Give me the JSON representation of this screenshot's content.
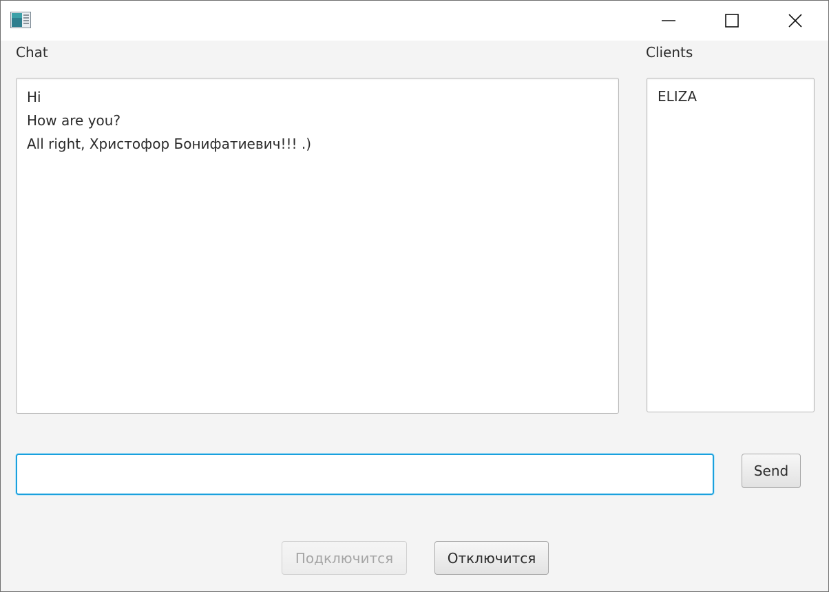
{
  "window": {
    "icon": "app-window-icon",
    "controls": {
      "minimize_icon": "minimize-icon",
      "maximize_icon": "maximize-icon",
      "close_icon": "close-icon"
    }
  },
  "chat": {
    "label": "Chat",
    "messages": [
      "Hi",
      "How are you?",
      "All right, Христофор Бонифатиевич!!! .)"
    ]
  },
  "clients": {
    "label": "Clients",
    "items": [
      "ELIZA"
    ]
  },
  "input": {
    "value": "",
    "placeholder": ""
  },
  "buttons": {
    "send_label": "Send",
    "connect_label": "Подключится",
    "connect_enabled": false,
    "disconnect_label": "Отключится",
    "disconnect_enabled": true
  },
  "colors": {
    "focus_border": "#1aa0dd",
    "window_bg": "#f4f4f4",
    "disabled_text": "#a5a5a5"
  }
}
